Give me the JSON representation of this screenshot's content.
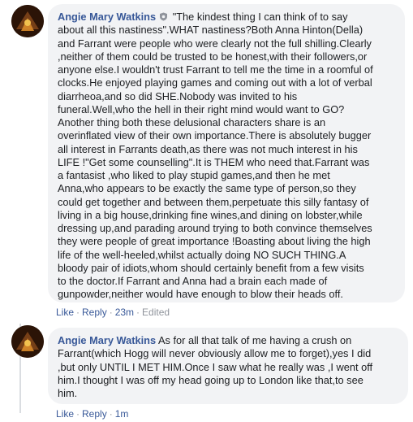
{
  "comments": [
    {
      "author": "Angie Mary Watkins",
      "badge_icon": "shield-badge-icon",
      "text": "\"The kindest thing I can think of to say\nabout all this nastiness\".WHAT nastiness?Both Anna Hinton(Della)\nand Farrant were people who were clearly not the full shilling.Clearly\n,neither of them could be trusted to be honest,with their followers,or\nanyone else.I wouldn't trust Farrant to tell me the time in a roomful of\nclocks.He enjoyed playing games and coming out with a lot of verbal\ndiarrheoa,and so did SHE.Nobody was invited to his\nfuneral.Well,who the hell in their right mind would want to GO?\nAnother thing both these delusional characters share is an\noverinflated view of their own importance.There is absolutely bugger\nall interest in Farrants death,as there was not much interest in his\nLIFE !\"Get some counselling\".It is THEM who need that.Farrant was\na fantasist ,who liked to play stupid games,and then he met\nAnna,who appears to be exactly the same type of person,so they\ncould get together and between them,perpetuate this silly fantasy of\nliving in a big house,drinking fine wines,and dining on lobster,while\ndressing up,and parading around trying to both convince themselves\nthey were people of great importance !Boasting about living the high\nlife of the well-heeled,whilst actually doing NO SUCH THING.A\nbloody pair of idiots,whom should certainly benefit from a few visits\nto the doctor.If Farrant and Anna had a brain each made of\ngunpowder,neither would have enough to blow their heads off.",
      "actions": {
        "like": "Like",
        "reply": "Reply",
        "sep": "·",
        "time": "23m",
        "edited": "Edited"
      }
    },
    {
      "author": "Angie Mary Watkins",
      "text": "As for all that talk of me having a crush on\nFarrant(which Hogg will never obviously allow me to forget),yes I did\n,but only UNTIL I MET HIM.Once I saw what he really was ,I went off\nhim.I thought I was off my head going up to London like that,to see\nhim.",
      "actions": {
        "like": "Like",
        "reply": "Reply",
        "sep": "·",
        "time": "1m"
      }
    }
  ],
  "colors": {
    "link": "#385898",
    "bubble": "#f2f3f5",
    "meta": "#90949c"
  }
}
